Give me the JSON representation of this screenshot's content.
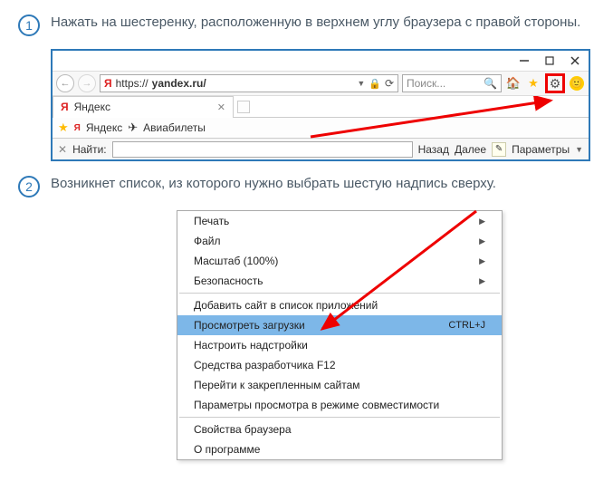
{
  "step1": {
    "num": "1",
    "text": "Нажать на шестеренку, расположенную в верхнем углу браузера с правой стороны."
  },
  "step2": {
    "num": "2",
    "text": "Возникнет список, из которого нужно выбрать шестую надпись сверху."
  },
  "browser": {
    "url_scheme": "https://",
    "url_host": "yandex.ru/",
    "search_placeholder": "Поиск...",
    "tab_title": "Яндекс",
    "bookmark_yandex": "Яндекс",
    "bookmark_avia": "Авиабилеты",
    "find_label": "Найти:",
    "find_back": "Назад",
    "find_next": "Далее",
    "find_params": "Параметры"
  },
  "menu": {
    "print": "Печать",
    "file": "Файл",
    "zoom": "Масштаб (100%)",
    "safety": "Безопасность",
    "add_site": "Добавить сайт в список приложений",
    "downloads": "Просмотреть загрузки",
    "downloads_shortcut": "CTRL+J",
    "addons": "Настроить надстройки",
    "f12": "Средства разработчика F12",
    "pinned": "Перейти к закрепленным сайтам",
    "compat": "Параметры просмотра в режиме совместимости",
    "props": "Свойства браузера",
    "about": "О программе"
  }
}
